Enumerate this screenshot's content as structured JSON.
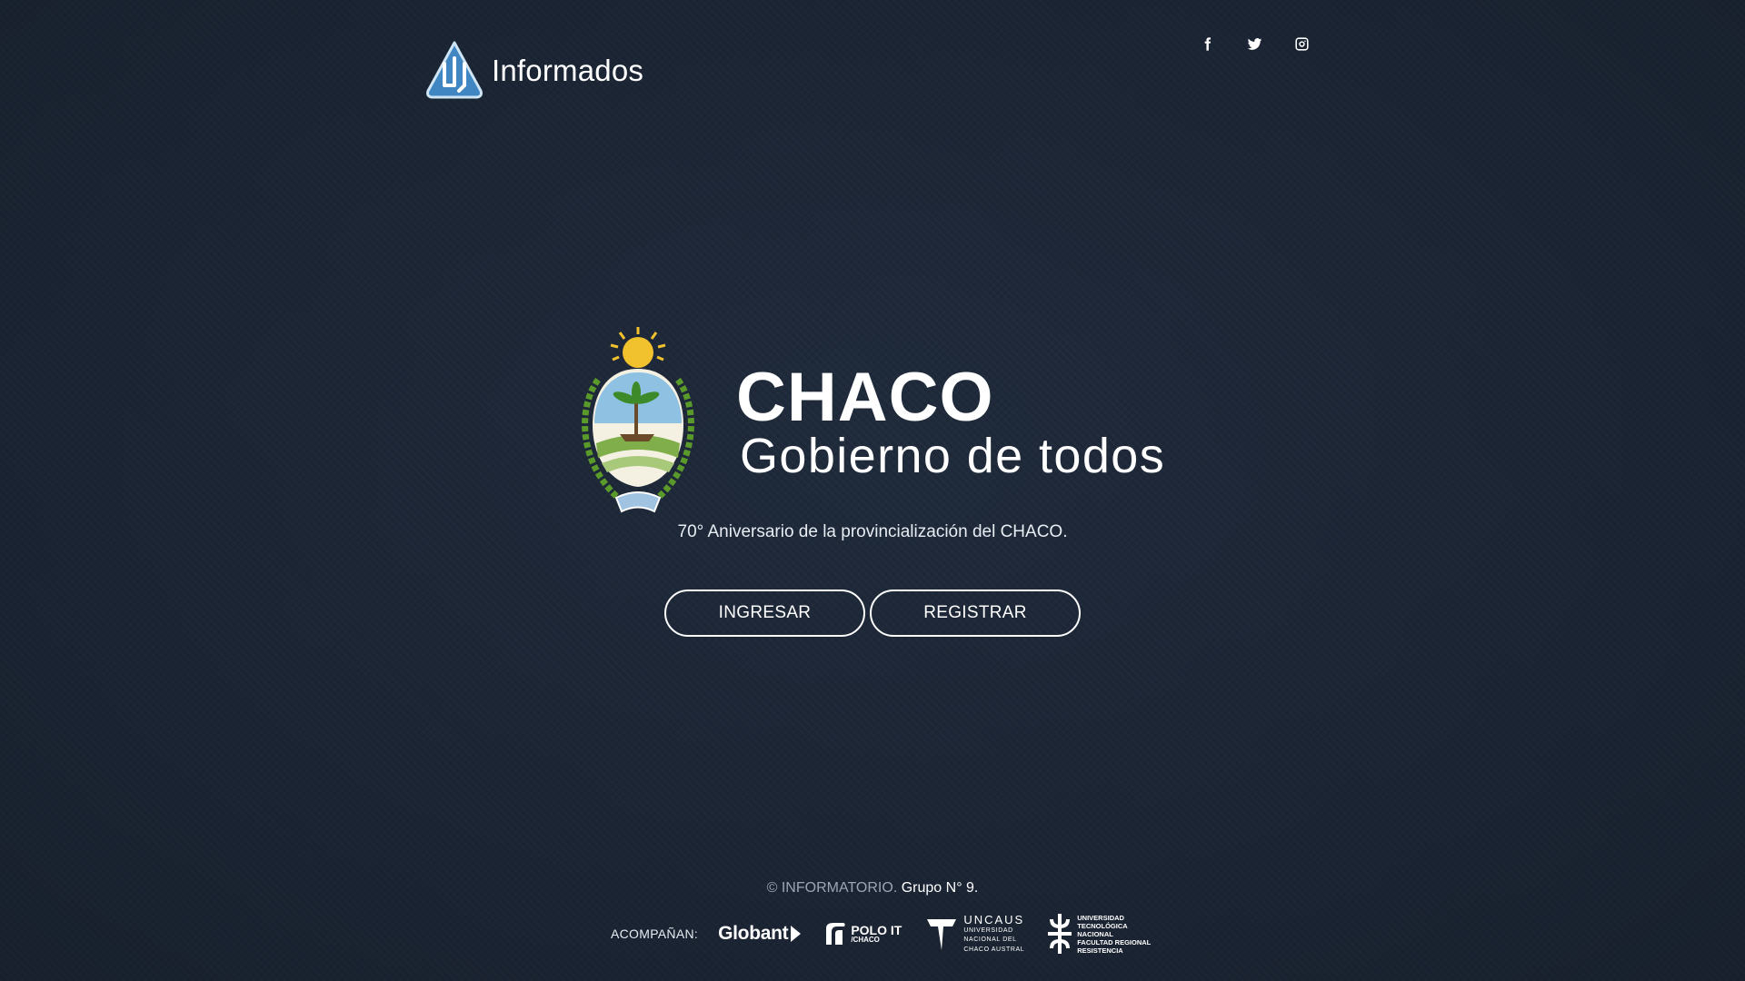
{
  "header": {
    "brand_name": "Informados",
    "social": [
      {
        "name": "facebook-icon"
      },
      {
        "name": "twitter-icon"
      },
      {
        "name": "instagram-icon"
      }
    ]
  },
  "hero": {
    "title": "CHACO",
    "subtitle": "Gobierno de todos",
    "tagline": "70° Aniversario de la provincialización del CHACO."
  },
  "actions": {
    "login_label": "INGRESAR",
    "register_label": "REGISTRAR"
  },
  "footer": {
    "copyright_org": "© INFORMATORIO.",
    "copyright_group": "Grupo N° 9.",
    "sponsors_label": "ACOMPAÑAN:",
    "sponsors": {
      "globant": "Globant",
      "polo_main": "POLO IT",
      "polo_sub": "/CHACO",
      "uncaus_main": "UNCAUS",
      "uncaus_line1": "UNIVERSIDAD",
      "uncaus_line2": "NACIONAL DEL",
      "uncaus_line3": "CHACO AUSTRAL",
      "utn_line1": "UNIVERSIDAD",
      "utn_line2": "TECNOLÓGICA NACIONAL",
      "utn_line3": "FACULTAD REGIONAL",
      "utn_line4": "RESISTENCIA"
    }
  },
  "colors": {
    "background": "#1f2a3b",
    "logo_blue": "#4a90c8",
    "crest_sky": "#8fc1e3",
    "crest_sun": "#f2c12e",
    "crest_laurel": "#5a9a2a"
  }
}
